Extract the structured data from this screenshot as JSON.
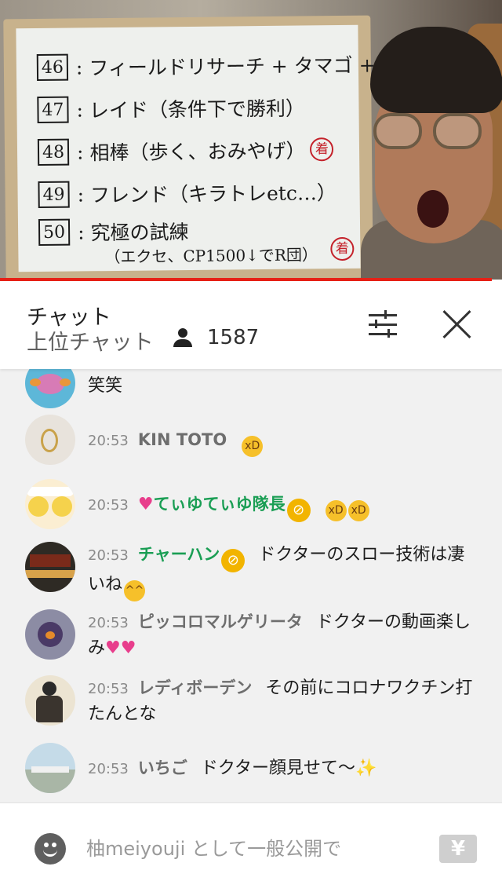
{
  "video": {
    "whiteboard_lines": [
      {
        "num": "46",
        "text": "フィールドリサーチ + タマゴ + スナップ",
        "stamp": ""
      },
      {
        "num": "47",
        "text": "レイド（条件下で勝利）",
        "stamp": ""
      },
      {
        "num": "48",
        "text": "相棒（歩く、おみやげ）",
        "stamp": "着"
      },
      {
        "num": "49",
        "text": "フレンド（キラトレetc…）",
        "stamp": ""
      },
      {
        "num": "50",
        "text": "究極の試練",
        "stamp": ""
      }
    ],
    "whiteboard_sub": "（エクセ、CP1500↓でR団）",
    "whiteboard_stamp_2": "着",
    "progress_fraction": 0.98,
    "progress_color": "#e62117"
  },
  "chat": {
    "title": "チャット",
    "mode": "上位チャット",
    "viewer_icon": "person-icon",
    "viewer_count": "1587",
    "filter_icon": "sliders-icon",
    "close_icon": "close-icon"
  },
  "messages": [
    {
      "time": "",
      "author": "",
      "member": false,
      "badge": false,
      "text": "笑笑",
      "emoji": ""
    },
    {
      "time": "20:53",
      "author": "KIN TOTO",
      "member": false,
      "badge": false,
      "text": "",
      "emoji": "rolling-laughing-icon"
    },
    {
      "time": "20:53",
      "author": "てぃゆてぃゆ隊長",
      "member": true,
      "badge": true,
      "text": "",
      "emoji": "rolling-laughing-icon x2"
    },
    {
      "time": "20:53",
      "author": "チャーハン",
      "member": true,
      "badge": true,
      "text": "ドクターのスロー技術は凄いね",
      "emoji": "grinning-face-icon"
    },
    {
      "time": "20:53",
      "author": "ピッコロマルゲリータ",
      "member": false,
      "badge": false,
      "text": "ドクターの動画楽しみ",
      "emoji": "two-hearts-icon"
    },
    {
      "time": "20:53",
      "author": "レディボーデン",
      "member": false,
      "badge": false,
      "text": "その前にコロナワクチン打たんとな",
      "emoji": ""
    },
    {
      "time": "20:53",
      "author": "いちご",
      "member": false,
      "badge": false,
      "text": "ドクター顔見せて〜",
      "emoji": "sparkles-icon"
    }
  ],
  "input": {
    "placeholder": "柚meiyouji として一般公開で",
    "emoji_icon": "smiley-icon",
    "superchat_label": "¥"
  },
  "colors": {
    "member_name": "#1a9e54",
    "member_badge": "#f2b400",
    "chat_background": "#f1f1f1"
  }
}
